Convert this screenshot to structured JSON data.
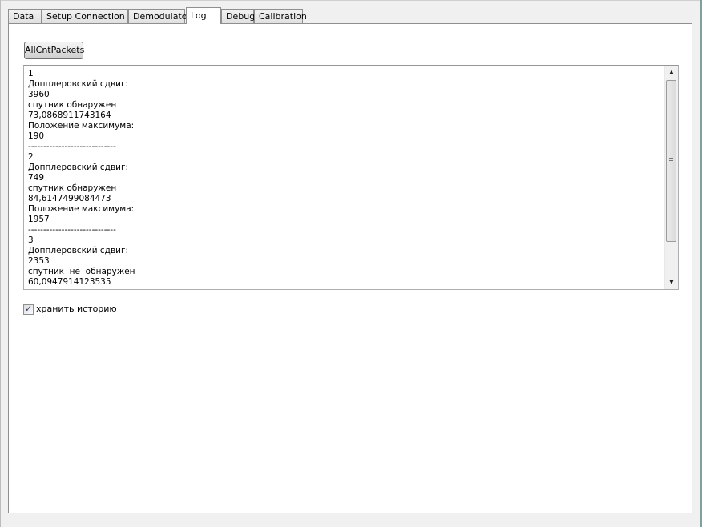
{
  "tabs": [
    {
      "label": "Data",
      "active": false
    },
    {
      "label": "Setup Connection",
      "active": false
    },
    {
      "label": "Demodulator",
      "active": false
    },
    {
      "label": "Log",
      "active": true
    },
    {
      "label": "Debug",
      "active": false
    },
    {
      "label": "Calibration",
      "active": false
    }
  ],
  "toolbar": {
    "all_cnt_packets_label": "AllCntPackets"
  },
  "log": {
    "lines": [
      "1",
      "Допплеровский сдвиг:",
      "3960",
      "спутник обнаружен",
      "73,0868911743164",
      "Положение максимума:",
      "190",
      "-----------------------------",
      "2",
      "Допплеровский сдвиг:",
      "749",
      "спутник обнаружен",
      "84,6147499084473",
      "Положение максимума:",
      "1957",
      "-----------------------------",
      "3",
      "Допплеровский сдвиг:",
      "2353",
      "спутник  не  обнаружен",
      "60,0947914123535"
    ],
    "scroll_fraction": 0
  },
  "scrollbar": {
    "up_icon": "▲",
    "down_icon": "▼"
  },
  "history": {
    "label": "хранить историю",
    "checked": true,
    "check_glyph": "✓"
  }
}
